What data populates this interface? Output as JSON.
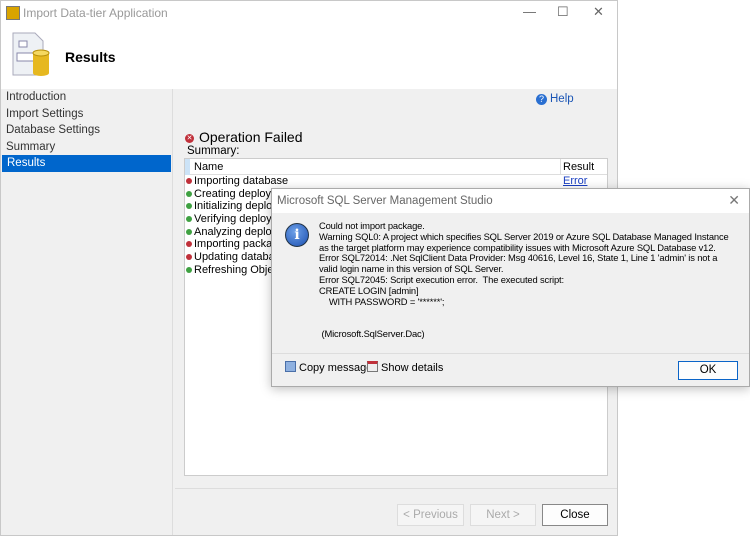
{
  "window": {
    "title": "Import Data-tier Application",
    "page_title": "Results"
  },
  "nav": [
    "Introduction",
    "Import Settings",
    "Database Settings",
    "Summary",
    "Results"
  ],
  "content": {
    "help": "Help",
    "status": "Operation Failed",
    "summary_label": "Summary:",
    "columns": [
      "Name",
      "Result"
    ],
    "rows": [
      {
        "name": "Importing database",
        "result": "Error",
        "status": "error"
      },
      {
        "name": "Creating deployme",
        "result": "",
        "status": "success"
      },
      {
        "name": "Initializing deploym",
        "result": "",
        "status": "success"
      },
      {
        "name": "Verifying deployme",
        "result": "",
        "status": "success"
      },
      {
        "name": "Analyzing deploym",
        "result": "",
        "status": "success"
      },
      {
        "name": "Importing package",
        "result": "",
        "status": "error"
      },
      {
        "name": "Updating database",
        "result": "",
        "status": "error"
      },
      {
        "name": "Refreshing Object E",
        "result": "",
        "status": "success"
      }
    ]
  },
  "buttons": {
    "previous": "< Previous",
    "next": "Next >",
    "close": "Close"
  },
  "dialog": {
    "title": "Microsoft SQL Server Management Studio",
    "message": "Could not import package.\nWarning SQL0: A project which specifies SQL Server 2019 or Azure SQL Database Managed Instance\nas the target platform may experience compatibility issues with Microsoft Azure SQL Database v12.\nError SQL72014: .Net SqlClient Data Provider: Msg 40616, Level 16, State 1, Line 1 'admin' is not a\nvalid login name in this version of SQL Server.\nError SQL72045: Script execution error.  The executed script:\nCREATE LOGIN [admin]\n    WITH PASSWORD = '******';\n\n\n (Microsoft.SqlServer.Dac)",
    "copy": "Copy message",
    "details": "Show details",
    "ok": "OK"
  },
  "colors": {
    "error": "#c0303a",
    "success": "#3fa142",
    "selected": "#0066cc"
  }
}
